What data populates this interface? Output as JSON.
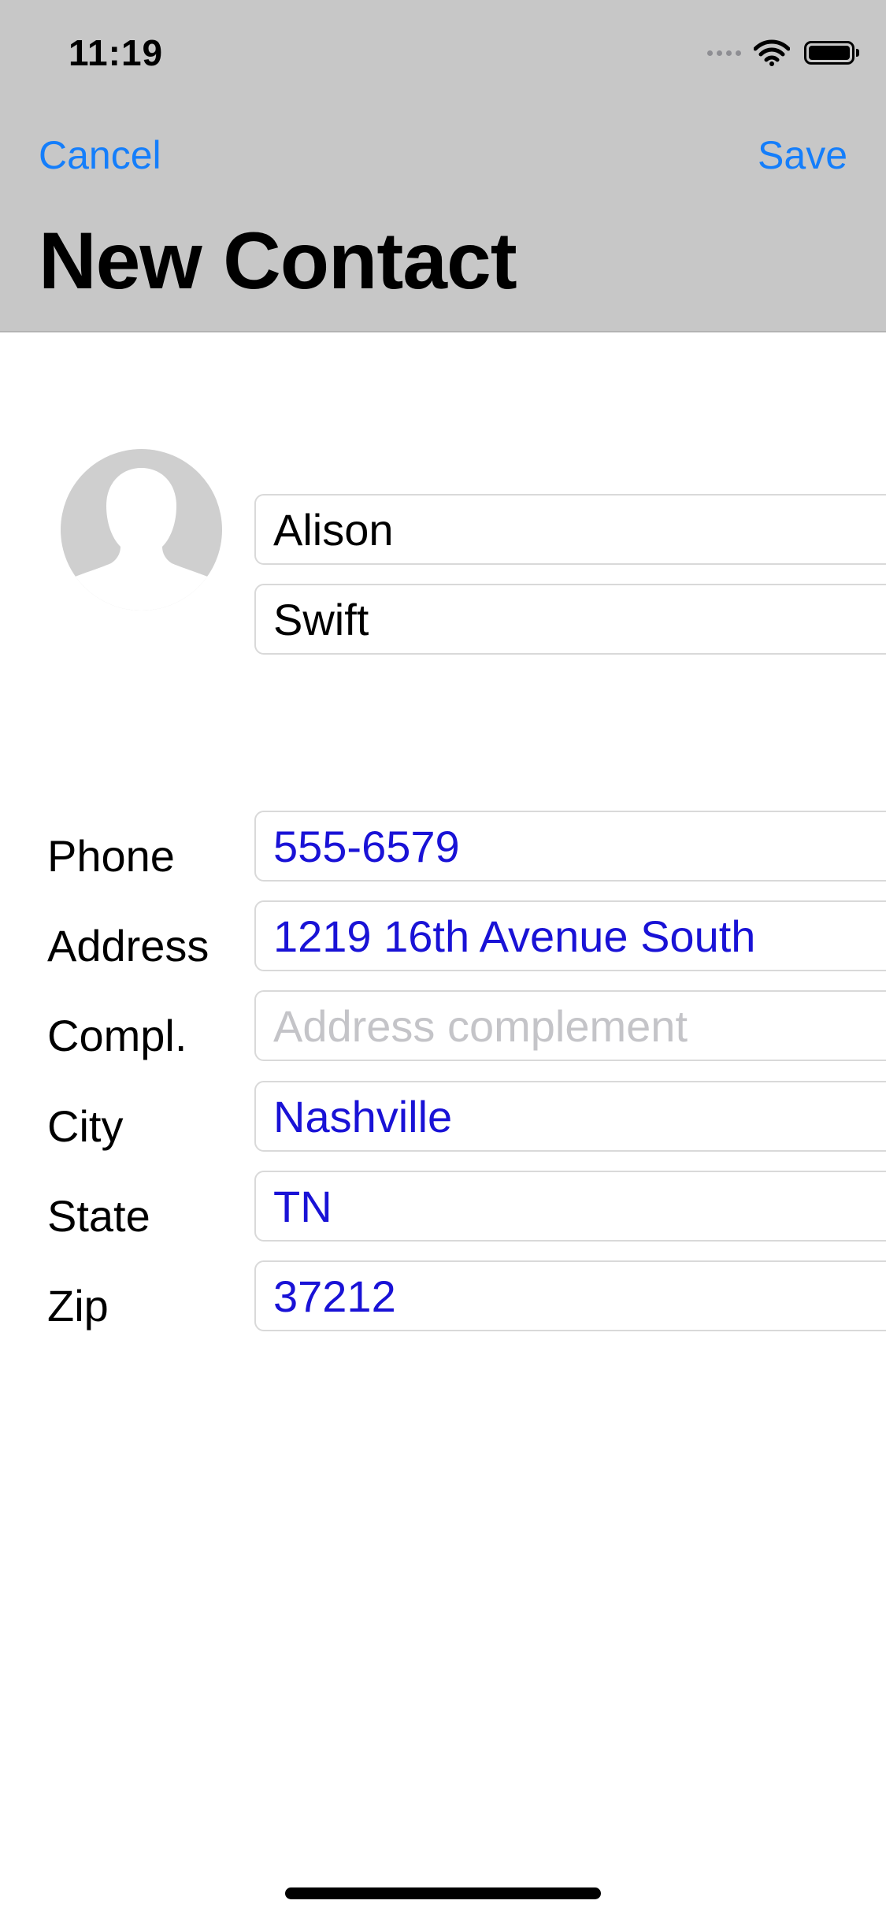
{
  "status_bar": {
    "time": "11:19"
  },
  "nav": {
    "cancel_label": "Cancel",
    "save_label": "Save",
    "title": "New Contact",
    "accent_color": "#147efb"
  },
  "name_fields": {
    "first_name": "Alison",
    "last_name": "Swift"
  },
  "form": {
    "phone": {
      "label": "Phone",
      "value": "555-6579"
    },
    "address": {
      "label": "Address",
      "value": "1219 16th Avenue South"
    },
    "complement": {
      "label": "Compl.",
      "placeholder": "Address complement"
    },
    "city": {
      "label": "City",
      "value": "Nashville"
    },
    "state": {
      "label": "State",
      "value": "TN"
    },
    "zip": {
      "label": "Zip",
      "value": "37212"
    }
  },
  "colors": {
    "header_bg": "#c7c7c7",
    "value_text": "#1912d6",
    "placeholder_text": "#c4c4c8"
  },
  "icons": {
    "avatar": "avatar-placeholder-icon",
    "signal": "cellular-signal-icon",
    "wifi": "wifi-icon",
    "battery": "battery-icon"
  }
}
